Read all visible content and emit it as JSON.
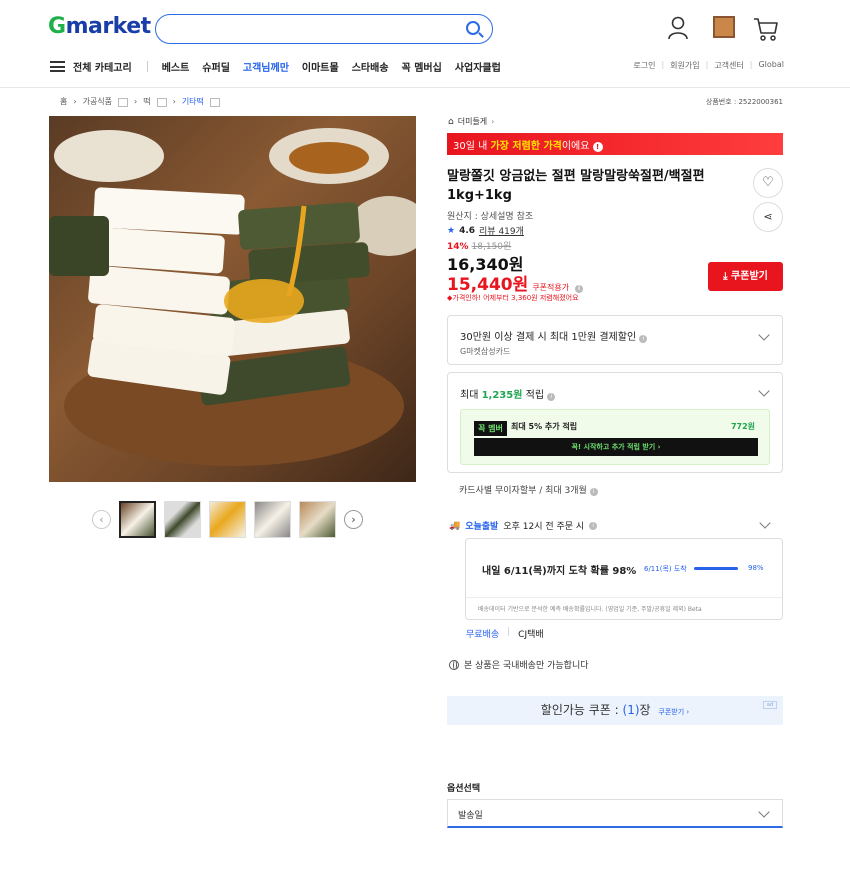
{
  "header": {
    "logo_g": "G",
    "logo_rest": "market",
    "search_placeholder": "",
    "nav": {
      "all_categories": "전체 카테고리",
      "items": [
        "베스트",
        "슈퍼딜",
        "고객님께만",
        "이마트몰",
        "스타배송",
        "꼭 멤버십",
        "사업자클럽"
      ]
    },
    "util": [
      "로그인",
      "회원가입",
      "고객센터",
      "Global"
    ]
  },
  "breadcrumb": [
    "홈",
    "가공식품",
    "떡",
    "기타떡"
  ],
  "product_no": "상품번호 : 2522000361",
  "store": {
    "name": "더미들게"
  },
  "promo_banner": {
    "prefix": "30일 내 ",
    "highlight": "가장 저렴한 가격",
    "suffix": "이에요"
  },
  "product": {
    "title": "말랑쫄깃 앙금없는 절편 말랑말랑쑥절편/백절편 1kg+1kg",
    "origin": "원산지 : 상세설명 참조",
    "rating": "4.6",
    "reviews": "리뷰 419개",
    "discount_pct": "14%",
    "original_price": "18,150원",
    "price": "16,340원",
    "coupon_price": "15,440원",
    "coupon_tag": "쿠폰적용가",
    "coupon_button": "쿠폰받기",
    "price_note": "가격인하! 어제부터 3,360원 저렴해졌어요"
  },
  "card_payment": {
    "title": "30만원 이상 결제 시 최대 1만원 결제할인",
    "sub": "G마켓삼성카드"
  },
  "points": {
    "prefix": "최대 ",
    "amount": "1,235원",
    "suffix": " 적립",
    "member_badge": "꼭 멤버",
    "member_text": "최대 5% 추가 적립",
    "member_points": "772원",
    "member_button": "꼭! 시작하고 추가 적립 받기 ›"
  },
  "installment": "카드사별 무이자할부 / 최대 3개월",
  "shipping": {
    "today_label": "오늘출발",
    "cutoff": "오후 12시 전 주문 시",
    "arrival": "내일 6/11(목)까지 도착 확률 98%",
    "date": "6/11(목) 도착",
    "percent": "98%",
    "progress": 0.98,
    "note": "배송데이터 기반으로 분석한 예측 배송확률입니다. (영업일 기준, 주말/공휴일 제외) Beta",
    "free": "무료배송",
    "carrier": "CJ택배"
  },
  "domestic": "본 상품은 국내배송만 가능합니다",
  "coupons": {
    "label": "할인가능 쿠폰 : ",
    "count": "(1)",
    "unit": "장",
    "link": "쿠폰받기 ›"
  },
  "options": {
    "label": "옵션선택",
    "selected": "발송일"
  },
  "colors": {
    "accent": "#2563eb",
    "red": "#e8141e",
    "green": "#20a550"
  }
}
